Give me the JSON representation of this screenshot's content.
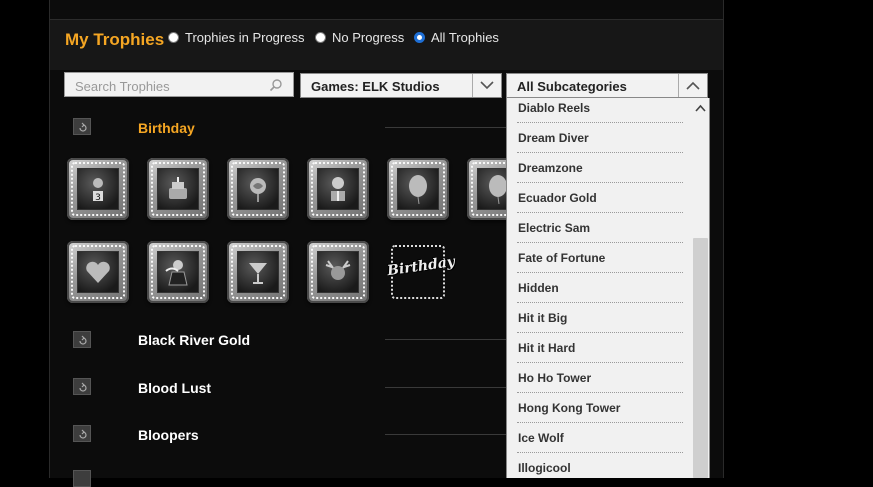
{
  "header": {
    "title": "My Trophies",
    "filters": [
      {
        "label": "Trophies in Progress",
        "checked": false
      },
      {
        "label": "No Progress",
        "checked": false
      },
      {
        "label": "All Trophies",
        "checked": true
      }
    ]
  },
  "search": {
    "placeholder": "Search Trophies",
    "value": ""
  },
  "games_select": {
    "value": "Games: ELK Studios"
  },
  "subcategory_select": {
    "value": "All Subcategories"
  },
  "categories": [
    {
      "name": "Birthday",
      "active": true
    },
    {
      "name": "Black River Gold",
      "active": false
    },
    {
      "name": "Blood Lust",
      "active": false
    },
    {
      "name": "Bloopers",
      "active": false
    }
  ],
  "birthday_trophies": [
    {
      "icon": "clown-3-icon"
    },
    {
      "icon": "cake-icon"
    },
    {
      "icon": "rose-icon"
    },
    {
      "icon": "gift-dog-icon"
    },
    {
      "icon": "balloon-icon"
    },
    {
      "icon": "balloon-icon"
    },
    {
      "icon": "heart-icon"
    },
    {
      "icon": "waiter-icon"
    },
    {
      "icon": "cocktail-icon"
    },
    {
      "icon": "moose-icon"
    },
    {
      "icon": "birthday-logo-icon",
      "text": "Birthday"
    }
  ],
  "subcategory_options": [
    "Diablo Reels",
    "Dream Diver",
    "Dreamzone",
    "Ecuador Gold",
    "Electric Sam",
    "Fate of Fortune",
    "Hidden",
    "Hit it Big",
    "Hit it Hard",
    "Ho Ho Tower",
    "Hong Kong Tower",
    "Ice Wolf",
    "Illogicool"
  ]
}
